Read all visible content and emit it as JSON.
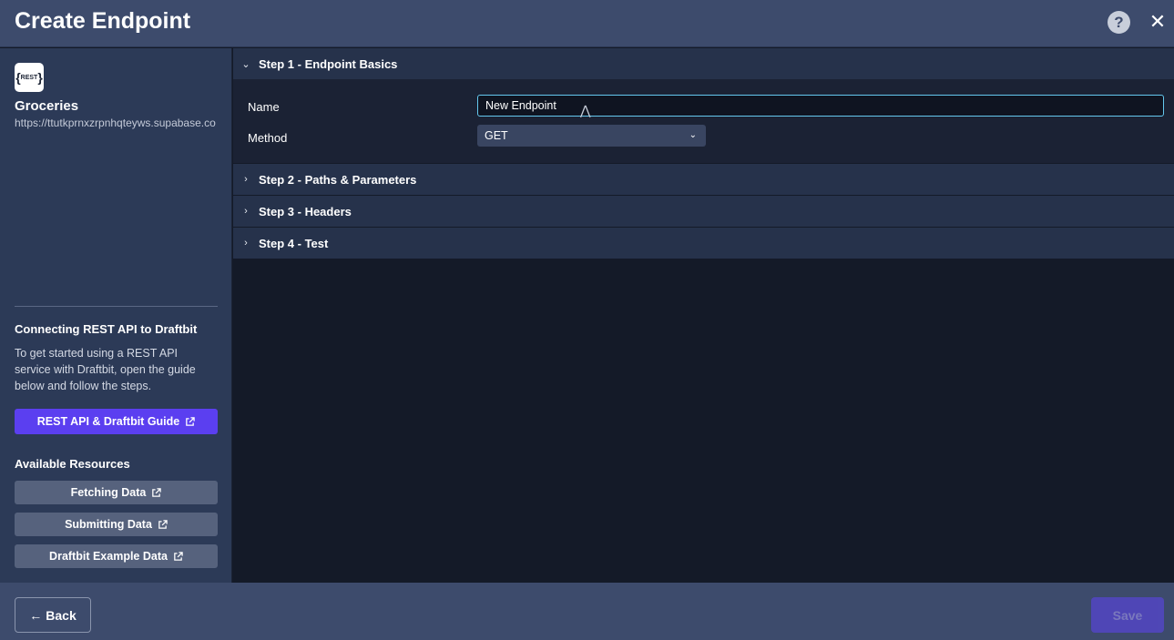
{
  "header": {
    "title": "Create Endpoint",
    "help_label": "?",
    "close_label": "✕"
  },
  "sidebar": {
    "logo_text": "REST",
    "datasource_name": "Groceries",
    "datasource_url": "https://ttutkprnxzrpnhqteyws.supabase.co",
    "guide_title": "Connecting REST API to Draftbit",
    "guide_text": "To get started using a REST API service with Draftbit, open the guide below and follow the steps.",
    "guide_button": "REST API & Draftbit Guide",
    "resources_title": "Available Resources",
    "resources": [
      {
        "label": "Fetching Data"
      },
      {
        "label": "Submitting Data"
      },
      {
        "label": "Draftbit Example Data"
      }
    ]
  },
  "steps": [
    {
      "label": "Step 1 - Endpoint Basics",
      "expanded": true
    },
    {
      "label": "Step 2 - Paths & Parameters",
      "expanded": false
    },
    {
      "label": "Step 3 - Headers",
      "expanded": false
    },
    {
      "label": "Step 4 - Test",
      "expanded": false
    }
  ],
  "form": {
    "name_label": "Name",
    "name_value": "New Endpoint",
    "method_label": "Method",
    "method_value": "GET"
  },
  "footer": {
    "back_label": "Back",
    "save_label": "Save"
  },
  "colors": {
    "accent": "#5b3ff0",
    "input_focus": "#64c8ee",
    "header_bg": "#3d4b6c"
  }
}
